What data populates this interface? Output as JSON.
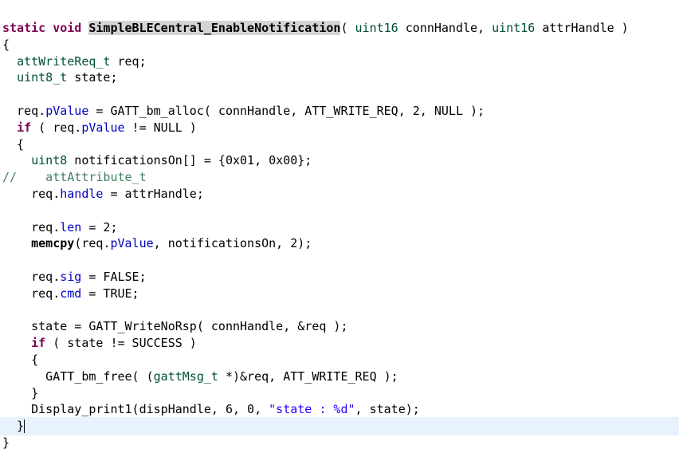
{
  "code_editor": {
    "lines": [
      [
        {
          "t": "static void ",
          "c": "kw"
        },
        {
          "t": "SimpleBLECentral_EnableNotification",
          "c": "fn-hl"
        },
        {
          "t": "( "
        },
        {
          "t": "uint16",
          "c": "type"
        },
        {
          "t": " connHandle, "
        },
        {
          "t": "uint16",
          "c": "type"
        },
        {
          "t": " attrHandle )"
        }
      ],
      [
        {
          "t": "{"
        }
      ],
      [
        {
          "t": "  "
        },
        {
          "t": "attWriteReq_t",
          "c": "type"
        },
        {
          "t": " req;"
        }
      ],
      [
        {
          "t": "  "
        },
        {
          "t": "uint8_t",
          "c": "type"
        },
        {
          "t": " state;"
        }
      ],
      [],
      [
        {
          "t": "  req."
        },
        {
          "t": "pValue",
          "c": "field"
        },
        {
          "t": " = GATT_bm_alloc( connHandle, ATT_WRITE_REQ, 2, NULL );"
        }
      ],
      [
        {
          "t": "  "
        },
        {
          "t": "if",
          "c": "kw"
        },
        {
          "t": " ( req."
        },
        {
          "t": "pValue",
          "c": "field"
        },
        {
          "t": " != NULL )"
        }
      ],
      [
        {
          "t": "  {"
        }
      ],
      [
        {
          "t": "    "
        },
        {
          "t": "uint8",
          "c": "type"
        },
        {
          "t": " notificationsOn[] = {0x01, 0x00};"
        }
      ],
      [
        {
          "t": "//    attAttribute_t",
          "c": "comment"
        }
      ],
      [
        {
          "t": "    req."
        },
        {
          "t": "handle",
          "c": "field"
        },
        {
          "t": " = attrHandle;"
        }
      ],
      [],
      [
        {
          "t": "    req."
        },
        {
          "t": "len",
          "c": "field"
        },
        {
          "t": " = 2;"
        }
      ],
      [
        {
          "t": "    "
        },
        {
          "t": "memcpy",
          "c": "fn-bold"
        },
        {
          "t": "(req."
        },
        {
          "t": "pValue",
          "c": "field"
        },
        {
          "t": ", notificationsOn, 2);"
        }
      ],
      [],
      [
        {
          "t": "    req."
        },
        {
          "t": "sig",
          "c": "field"
        },
        {
          "t": " = FALSE;"
        }
      ],
      [
        {
          "t": "    req."
        },
        {
          "t": "cmd",
          "c": "field"
        },
        {
          "t": " = TRUE;"
        }
      ],
      [],
      [
        {
          "t": "    state = GATT_WriteNoRsp( connHandle, &req );"
        }
      ],
      [
        {
          "t": "    "
        },
        {
          "t": "if",
          "c": "kw"
        },
        {
          "t": " ( state != SUCCESS )"
        }
      ],
      [
        {
          "t": "    {"
        }
      ],
      [
        {
          "t": "      GATT_bm_free( ("
        },
        {
          "t": "gattMsg_t",
          "c": "type"
        },
        {
          "t": " *)&req, ATT_WRITE_REQ );"
        }
      ],
      [
        {
          "t": "    }"
        }
      ],
      [
        {
          "t": "    Display_print1(dispHandle, 6, 0, "
        },
        {
          "t": "\"state : %d\"",
          "c": "str"
        },
        {
          "t": ", state);"
        }
      ],
      [
        {
          "t": "  }"
        }
      ],
      [
        {
          "t": "}"
        }
      ]
    ],
    "current_line": 24,
    "caret_column": 3
  }
}
